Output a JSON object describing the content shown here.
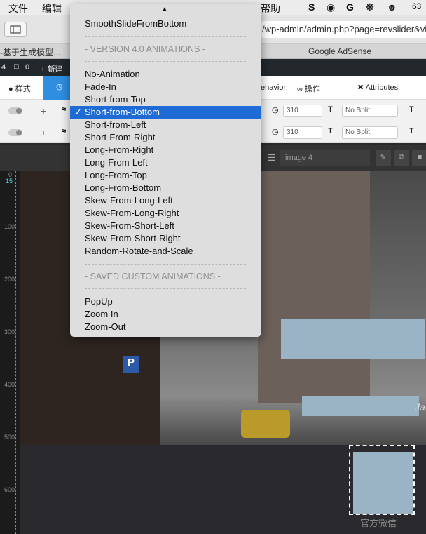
{
  "menubar": {
    "items": [
      "文件",
      "编辑",
      "帮助"
    ],
    "right_glyph": "63"
  },
  "browser": {
    "url": "/wp-admin/admin.php?page=revslider&vie"
  },
  "tabs": [
    "-基于生成模型...",
    "Google AdSense"
  ],
  "wpbar": {
    "count_a": "4",
    "count_b": "0",
    "new_label": "+ 新建"
  },
  "toolbar": {
    "style_tab": "样式",
    "behavior_tab": "ehavior",
    "actions_tab": "操作",
    "attributes_tab": "Attributes"
  },
  "layer_rows": [
    {
      "time": "310",
      "split": "No Split",
      "plus": "+"
    },
    {
      "time": "310",
      "split": "No Split",
      "plus": "+"
    }
  ],
  "layer_bar": {
    "layer_name": "image 4"
  },
  "ruler": {
    "marks": [
      "0",
      "15",
      "100",
      "200",
      "300",
      "400",
      "500",
      "600"
    ]
  },
  "canvas": {
    "watermark": "官方微信",
    "partial_text": "Ja"
  },
  "dropdown": {
    "top_item": "SmoothSlideFromBottom",
    "section_v4": "- VERSION 4.0 ANIMATIONS -",
    "v4_items": [
      "No-Animation",
      "Fade-In",
      "Short-from-Top",
      "Short-from-Bottom",
      "Short-from-Left",
      "Short-From-Right",
      "Long-From-Right",
      "Long-From-Left",
      "Long-From-Top",
      "Long-From-Bottom",
      "Skew-From-Long-Left",
      "Skew-From-Long-Right",
      "Skew-From-Short-Left",
      "Skew-From-Short-Right",
      "Random-Rotate-and-Scale"
    ],
    "selected": "Short-from-Bottom",
    "section_custom": "- SAVED CUSTOM ANIMATIONS -",
    "custom_items": [
      "PopUp",
      "Zoom In",
      "Zoom-Out"
    ],
    "check_glyph": "✓",
    "scroll_up_glyph": "▲"
  },
  "colors": {
    "selection": "#1f6bd6",
    "placeholder_box": "#9ab4c6",
    "tab_active": "#2f8ee0"
  }
}
